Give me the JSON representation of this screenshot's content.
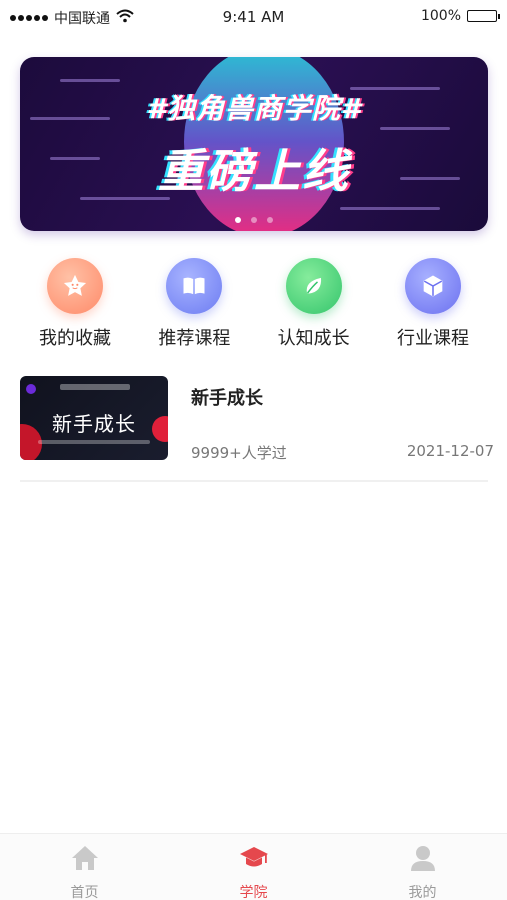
{
  "status_bar": {
    "carrier": "中国联通",
    "time": "9:41 AM",
    "battery": "100%",
    "battery_level": 1.0
  },
  "banner": {
    "tagline": "#独角兽商学院#",
    "headline": "重磅上线",
    "slide_count": 3,
    "active_slide": 1
  },
  "quick_nav": [
    {
      "label": "我的收藏",
      "icon": "star-icon",
      "color": "#ff8a69"
    },
    {
      "label": "推荐课程",
      "icon": "book-icon",
      "color": "#6d7cf2"
    },
    {
      "label": "认知成长",
      "icon": "leaf-icon",
      "color": "#34c56c"
    },
    {
      "label": "行业课程",
      "icon": "cube-icon",
      "color": "#6c71f0"
    }
  ],
  "courses": [
    {
      "thumbnail_title": "新手成长",
      "title": "新手成长",
      "learners": "9999+人学过",
      "date": "2021-12-07"
    }
  ],
  "tab_bar": {
    "items": [
      {
        "label": "首页",
        "icon": "home-icon",
        "active": false
      },
      {
        "label": "学院",
        "icon": "graduation-cap-icon",
        "active": true
      },
      {
        "label": "我的",
        "icon": "person-icon",
        "active": false
      }
    ],
    "active_color": "#e5484d",
    "inactive_color": "#9a9a9a"
  }
}
